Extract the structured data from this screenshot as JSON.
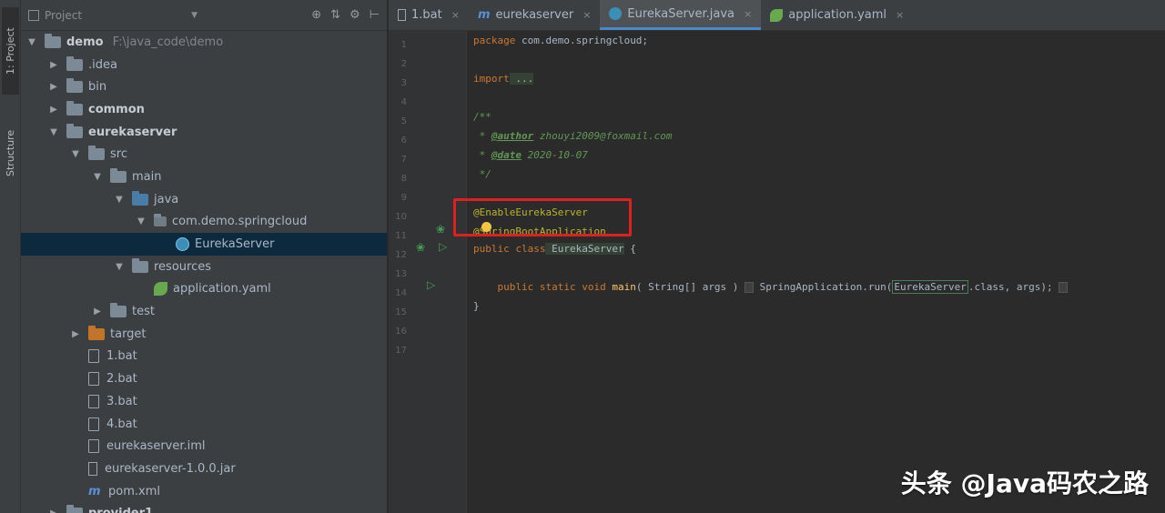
{
  "toolstrip": {
    "project_tab": "1: Project",
    "structure_tab": "Structure"
  },
  "project_panel": {
    "title": "Project",
    "tools": [
      "⊕",
      "⇅",
      "⚙",
      "⊢"
    ]
  },
  "tree": [
    {
      "label": "demo",
      "path": "F:\\java_code\\demo",
      "depth": 0,
      "arrow": "▼",
      "icon": "folder",
      "bold": true
    },
    {
      "label": ".idea",
      "depth": 1,
      "arrow": "▶",
      "icon": "folder"
    },
    {
      "label": "bin",
      "depth": 1,
      "arrow": "▶",
      "icon": "folder"
    },
    {
      "label": "common",
      "depth": 1,
      "arrow": "▶",
      "icon": "folder",
      "bold": true
    },
    {
      "label": "eurekaserver",
      "depth": 1,
      "arrow": "▼",
      "icon": "folder",
      "bold": true
    },
    {
      "label": "src",
      "depth": 2,
      "arrow": "▼",
      "icon": "folder"
    },
    {
      "label": "main",
      "depth": 3,
      "arrow": "▼",
      "icon": "folder"
    },
    {
      "label": "java",
      "depth": 4,
      "arrow": "▼",
      "icon": "folder-blue"
    },
    {
      "label": "com.demo.springcloud",
      "depth": 5,
      "arrow": "▼",
      "icon": "package"
    },
    {
      "label": "EurekaServer",
      "depth": 6,
      "arrow": "",
      "icon": "class",
      "selected": true
    },
    {
      "label": "resources",
      "depth": 4,
      "arrow": "▼",
      "icon": "folder-res"
    },
    {
      "label": "application.yaml",
      "depth": 5,
      "arrow": "",
      "icon": "spring"
    },
    {
      "label": "test",
      "depth": 3,
      "arrow": "▶",
      "icon": "folder"
    },
    {
      "label": "target",
      "depth": 2,
      "arrow": "▶",
      "icon": "folder-orange"
    },
    {
      "label": "1.bat",
      "depth": 2,
      "arrow": "",
      "icon": "file"
    },
    {
      "label": "2.bat",
      "depth": 2,
      "arrow": "",
      "icon": "file"
    },
    {
      "label": "3.bat",
      "depth": 2,
      "arrow": "",
      "icon": "file"
    },
    {
      "label": "4.bat",
      "depth": 2,
      "arrow": "",
      "icon": "file"
    },
    {
      "label": "eurekaserver.iml",
      "depth": 2,
      "arrow": "",
      "icon": "file"
    },
    {
      "label": "eurekaserver-1.0.0.jar",
      "depth": 2,
      "arrow": "",
      "icon": "jar"
    },
    {
      "label": "pom.xml",
      "depth": 2,
      "arrow": "",
      "icon": "maven"
    },
    {
      "label": "provider1",
      "depth": 1,
      "arrow": "▶",
      "icon": "folder",
      "bold": true
    }
  ],
  "tabs": [
    {
      "label": "1.bat",
      "icon": "file",
      "active": false
    },
    {
      "label": "eurekaserver",
      "icon": "maven",
      "active": false
    },
    {
      "label": "EurekaServer.java",
      "icon": "class",
      "active": true
    },
    {
      "label": "application.yaml",
      "icon": "spring",
      "active": false
    }
  ],
  "tab_close": "×",
  "gutter": {
    "line_numbers": [
      "1",
      "2",
      "3",
      "4",
      "5",
      "6",
      "7",
      "8",
      "9",
      "10",
      "11",
      "12",
      "13",
      "14",
      "15",
      "16",
      "17"
    ]
  },
  "code": {
    "package_kw": "package",
    "package_name": " com.demo.springcloud;",
    "import_kw": "import",
    "import_fold": " ...",
    "doc_open": "/**",
    "author_tag": "@author",
    "author_val": " zhouyi2009@foxmail.com",
    "date_tag": "@date",
    "date_val": " 2020-10-07",
    "doc_close": " */",
    "ann1": "@EnableEurekaServer",
    "ann2": "@SpringBootApplication",
    "class_kw": "public class",
    "class_name": " EurekaServer",
    "class_brace": " {",
    "main_kw": "public static void",
    "main_name": " main",
    "main_params": "( String[] args ) ",
    "main_body": " SpringApplication.run(",
    "main_ref": "EurekaServer",
    "main_tail": ".class, args);",
    "close_brace": "}"
  },
  "watermark": "头条 @Java码农之路"
}
